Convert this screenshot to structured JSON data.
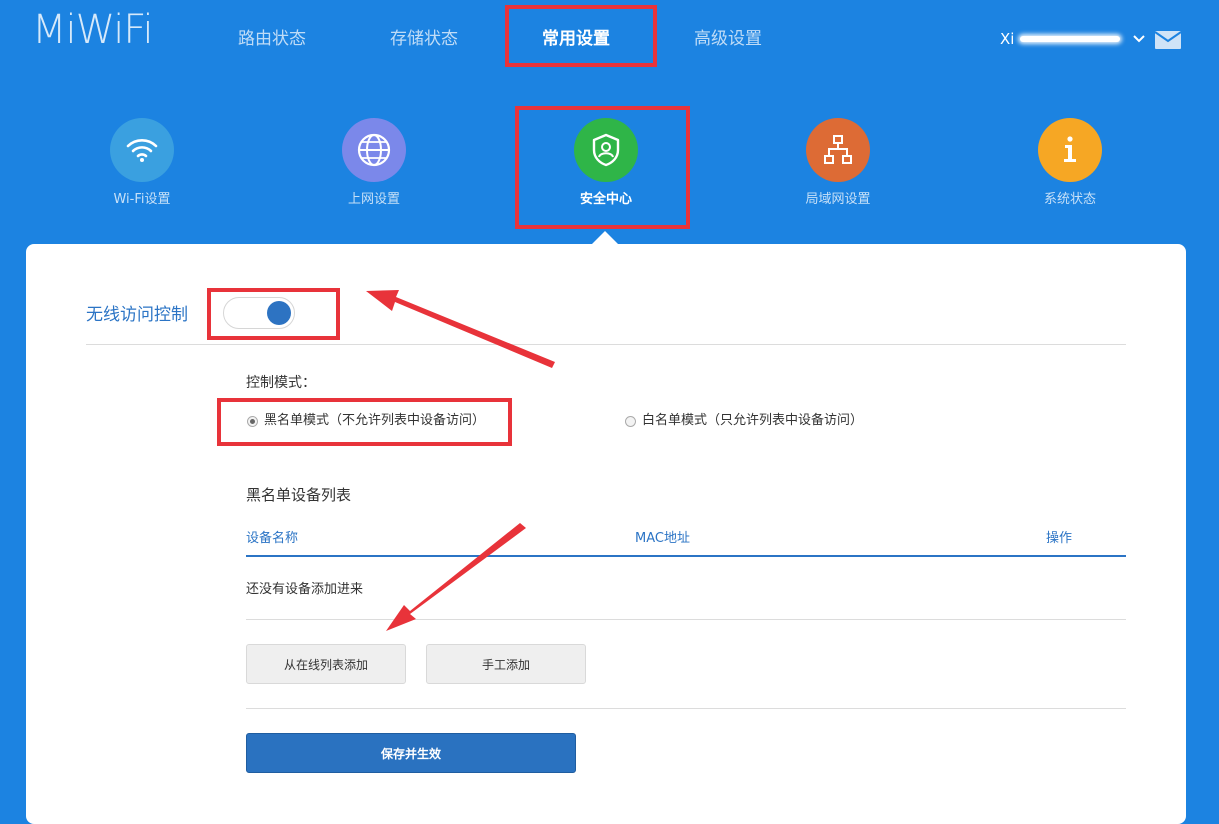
{
  "header": {
    "logo": "MiWiFi",
    "nav": [
      {
        "label": "路由状态"
      },
      {
        "label": "存储状态"
      },
      {
        "label": "常用设置",
        "active": true
      },
      {
        "label": "高级设置"
      }
    ],
    "user_prefix": "Xi"
  },
  "categories": [
    {
      "label": "Wi-Fi设置",
      "icon": "wifi-icon",
      "color": "#3aa0e0"
    },
    {
      "label": "上网设置",
      "icon": "globe-icon",
      "color": "#7b88ea"
    },
    {
      "label": "安全中心",
      "icon": "shield-icon",
      "color": "#2fb548",
      "active": true
    },
    {
      "label": "局域网设置",
      "icon": "network-icon",
      "color": "#dd6b35"
    },
    {
      "label": "系统状态",
      "icon": "info-icon",
      "color": "#f6a724"
    }
  ],
  "panel": {
    "section_title": "无线访问控制",
    "toggle_on": true,
    "mode_label": "控制模式：",
    "modes": [
      {
        "label": "黑名单模式（不允许列表中设备访问）",
        "checked": true
      },
      {
        "label": "白名单模式（只允许列表中设备访问）",
        "checked": false
      }
    ],
    "list_title": "黑名单设备列表",
    "columns": [
      "设备名称",
      "MAC地址",
      "操作"
    ],
    "empty_text": "还没有设备添加进来",
    "buttons": {
      "add_from_online": "从在线列表添加",
      "manual_add": "手工添加",
      "save": "保存并生效"
    }
  },
  "colors": {
    "background": "#1c83e1",
    "accent": "#2b74c5",
    "highlight": "#e8333a"
  }
}
